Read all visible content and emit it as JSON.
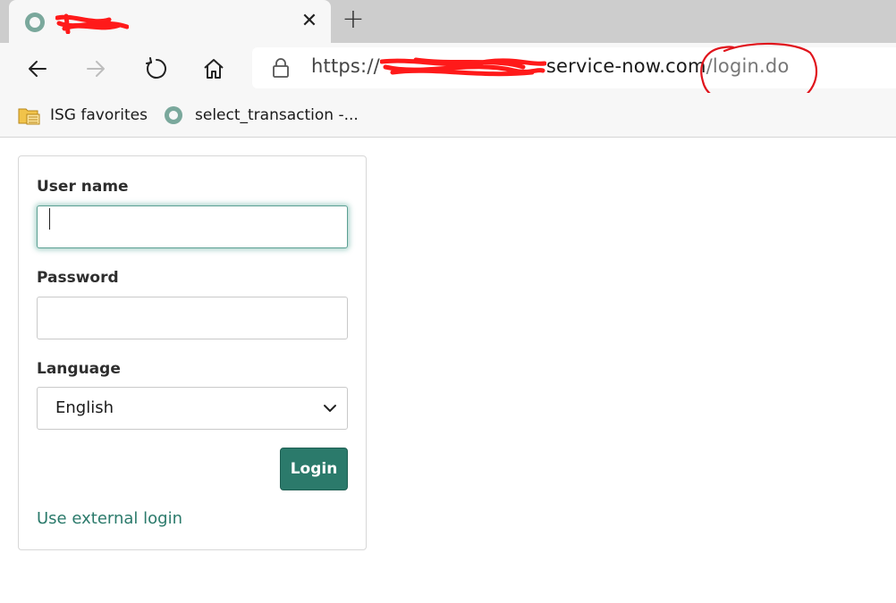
{
  "browser": {
    "tab": {
      "close_glyph": "✕",
      "favicon": "servicenow-favicon"
    },
    "new_tab_glyph": "+",
    "url": {
      "scheme": "https://",
      "domain_suffix": "service-now.com",
      "path": "/login.do"
    },
    "favorites": [
      {
        "label": "ISG favorites",
        "icon": "folder-icon"
      },
      {
        "label": "select_transaction -...",
        "icon": "servicenow-favicon"
      }
    ]
  },
  "login": {
    "username_label": "User name",
    "username_value": "",
    "password_label": "Password",
    "password_value": "",
    "language_label": "Language",
    "language_selected": "English",
    "login_button": "Login",
    "external_login_link": "Use external login"
  },
  "colors": {
    "accent": "#2b7a6b",
    "annotation": "#e0141c"
  }
}
